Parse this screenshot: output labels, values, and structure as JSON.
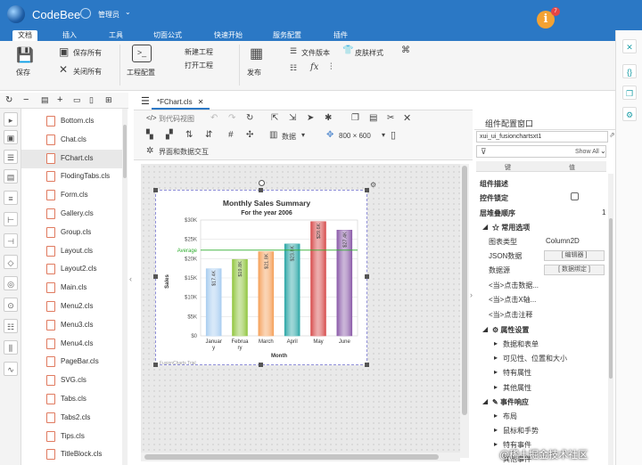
{
  "app": {
    "name": "CodeBee",
    "user": "管理员",
    "notification_count": "7"
  },
  "menu": [
    "文档",
    "插入",
    "工具",
    "切面公式",
    "快速开始",
    "服务配置",
    "插件"
  ],
  "ribbon": {
    "save": "保存",
    "save_all": "保存所有",
    "close_all": "关闭所有",
    "project_config": "工程配置",
    "new_project": "新建工程",
    "open_project": "打开工程",
    "publish": "发布",
    "file_version": "文件版本",
    "skin_style": "皮肤样式"
  },
  "files": [
    "Bottom.cls",
    "Chat.cls",
    "FChart.cls",
    "FlodingTabs.cls",
    "Form.cls",
    "Gallery.cls",
    "Group.cls",
    "Layout.cls",
    "Layout2.cls",
    "Main.cls",
    "Menu2.cls",
    "Menu3.cls",
    "Menu4.cls",
    "PageBar.cls",
    "SVG.cls",
    "Tabs.cls",
    "Tabs2.cls",
    "Tips.cls",
    "TitleBlock.cls"
  ],
  "selected_file": "FChart.cls",
  "editor": {
    "tab": "*FChart.cls",
    "view_code": "到代码视图",
    "data_label": "数据",
    "size": "800 × 600",
    "interaction": "界面和数据交互"
  },
  "chart_data": {
    "type": "bar",
    "title": "Monthly Sales Summary",
    "subtitle": "For the year 2006",
    "xlabel": "Month",
    "ylabel": "Sales",
    "categories": [
      "January",
      "February",
      "March",
      "April",
      "May",
      "June"
    ],
    "category_labels": [
      [
        "Januar",
        "y"
      ],
      [
        "Februa",
        "ry"
      ],
      [
        "March"
      ],
      [
        "April"
      ],
      [
        "May"
      ],
      [
        "June"
      ]
    ],
    "values": [
      17400,
      19800,
      21800,
      23800,
      29600,
      27400
    ],
    "value_labels": [
      "$17.4K",
      "$19.8K",
      "$21.8K",
      "$23.8K",
      "$29.6K",
      "$27.4K"
    ],
    "colors": [
      "#a9cdf0",
      "#8fc53c",
      "#f5a05a",
      "#2aa6a6",
      "#d64a4a",
      "#8a5aa8"
    ],
    "ylim": [
      0,
      30000
    ],
    "yticks": [
      0,
      5000,
      10000,
      15000,
      20000,
      25000,
      30000
    ],
    "ytick_labels": [
      "$0",
      "$5K",
      "$10K",
      "$15K",
      "$20K",
      "$25K",
      "$30K"
    ],
    "trendline": {
      "label": "Average",
      "value": 22200,
      "color": "#2fae2f"
    },
    "trial_text": "FusionCharts Trial"
  },
  "panel": {
    "title": "组件配置窗口",
    "component_id": "xui_ui_fusionchartsxt1",
    "show_all": "Show All",
    "col_key": "键",
    "col_value": "值",
    "rows": {
      "desc": "组件描述",
      "lock": "控件锁定",
      "zorder": "层堆叠顺序",
      "zorder_val": "1",
      "common": "常用选项",
      "chart_type": "图表类型",
      "chart_type_val": "Column2D",
      "json_data": "JSON数据",
      "editor_btn": "[ 编辑器 ]",
      "data_source": "数据源",
      "data_bind_btn": "[ 数据绑定 ]",
      "click_data": "<当>点击数据...",
      "click_x": "<当>点击X轴...",
      "click_note": "<当>点击注释",
      "prop_settings": "属性设置",
      "data_table": "数据和表单",
      "visibility": "可见性、位置和大小",
      "special": "特有属性",
      "other": "其他属性",
      "events": "事件响应",
      "layout": "布局",
      "mouse": "鼠标和手势",
      "special_events": "特有事件",
      "other_events": "其他事件"
    }
  },
  "watermark": "@稀土掘金技术社区"
}
